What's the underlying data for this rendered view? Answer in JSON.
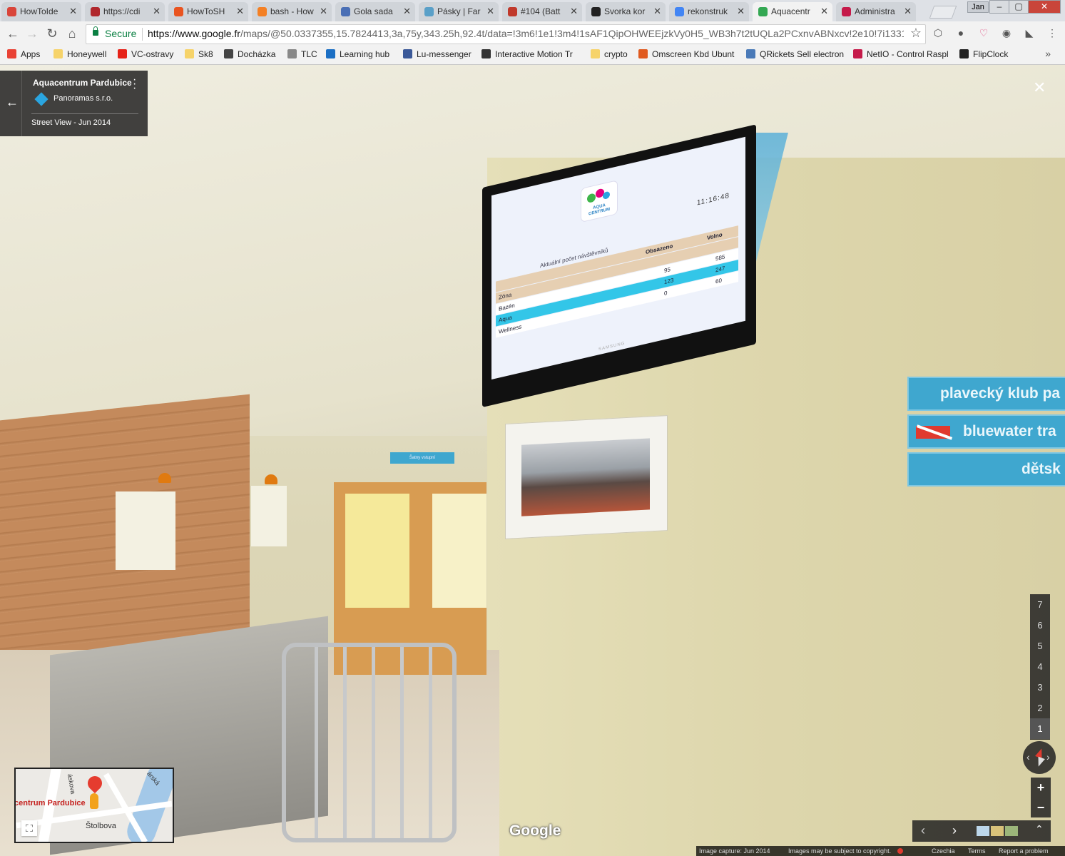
{
  "tabs": [
    {
      "title": "HowToIde",
      "icon": "howtoide-icon",
      "color": "#d9453a"
    },
    {
      "title": "https://cdi",
      "icon": "arrow-a-icon",
      "color": "#b0282d"
    },
    {
      "title": "HowToSH",
      "icon": "ubuntu-icon",
      "color": "#e95420"
    },
    {
      "title": "bash - How",
      "icon": "stackoverflow-icon",
      "color": "#f48024"
    },
    {
      "title": "Gola sada",
      "icon": "clip-icon",
      "color": "#4a6fb5"
    },
    {
      "title": "Pásky | Far",
      "icon": "tape-icon",
      "color": "#5aa0c8"
    },
    {
      "title": "#104 (Batt",
      "icon": "paw-icon",
      "color": "#c0392b"
    },
    {
      "title": "Svorka kor",
      "icon": "svorka-icon",
      "color": "#222222"
    },
    {
      "title": "rekonstruk",
      "icon": "google-icon",
      "color": "#4285f4"
    },
    {
      "title": "Aquacentr",
      "icon": "maps-icon",
      "color": "#34a853"
    },
    {
      "title": "Administra",
      "icon": "raspberry-icon",
      "color": "#c51a4a"
    }
  ],
  "window": {
    "user": "Jan"
  },
  "address": {
    "secure_label": "Secure",
    "url_host": "https://www.google.fr",
    "url_rest": "/maps/@50.0337355,15.7824413,3a,75y,343.25h,92.4t/data=!3m6!1e1!3m4!1sAF1QipOHWEEjzkVy0H5_WB3h7t2tUQLa2PCxnvABNxcv!2e10!7i13312!..."
  },
  "bookmarks": [
    {
      "label": "Apps",
      "icon": "apps-grid-icon",
      "color": "#e94235"
    },
    {
      "label": "Honeywell",
      "icon": "folder-icon",
      "color": "#f6d36a"
    },
    {
      "label": "VC-ostravy",
      "icon": "youtube-icon",
      "color": "#e62117"
    },
    {
      "label": "Sk8",
      "icon": "folder-icon",
      "color": "#f6d36a"
    },
    {
      "label": "Docházka",
      "icon": "clock-icon",
      "color": "#444444"
    },
    {
      "label": "TLC",
      "icon": "page-icon",
      "color": "#888888"
    },
    {
      "label": "Learning hub",
      "icon": "salesforce-icon",
      "color": "#1b6fc4"
    },
    {
      "label": "Lu-messenger",
      "icon": "facebook-icon",
      "color": "#3b5998"
    },
    {
      "label": "Interactive Motion Tr",
      "icon": "motion-icon",
      "color": "#333333"
    },
    {
      "label": "crypto",
      "icon": "folder-icon",
      "color": "#f6d36a"
    },
    {
      "label": "Omscreen Kbd Ubunt",
      "icon": "ask-icon",
      "color": "#e05a1f"
    },
    {
      "label": "QRickets Sell electron",
      "icon": "feather-icon",
      "color": "#4a7ab8"
    },
    {
      "label": "NetIO - Control Raspl",
      "icon": "raspberry-icon",
      "color": "#c51a4a"
    },
    {
      "label": "FlipClock",
      "icon": "flipclock-icon",
      "color": "#222222"
    }
  ],
  "place_card": {
    "title": "Aquacentrum Pardubice",
    "owner": "Panoramas s.r.o.",
    "date": "Street View - Jun 2014"
  },
  "tv": {
    "logo_text": "AQUA CENTRUM",
    "time": "11:16:48",
    "caption": "Aktuální počet návštěvníků",
    "col_occupied": "Obsazeno",
    "col_free": "Volno",
    "rows": [
      {
        "zone": "Zóna",
        "occupied": "",
        "free": ""
      },
      {
        "zone": "Bazén",
        "occupied": "95",
        "free": "585"
      },
      {
        "zone": "Aqua",
        "occupied": "123",
        "free": "247"
      },
      {
        "zone": "Wellness",
        "occupied": "0",
        "free": "60"
      }
    ],
    "brand": "SAMSUNG"
  },
  "signs": [
    "plavecký klub pa",
    "bluewater tra",
    "dětsk"
  ],
  "door_sign": "Šatny vstupní",
  "levels": [
    "7",
    "6",
    "5",
    "4",
    "3",
    "2",
    "1"
  ],
  "selected_level": "1",
  "minimap": {
    "label_place": "centrum Pardubice",
    "street1": "Štolbova",
    "street2": "áskova",
    "street3": "árská"
  },
  "google_logo": "Google",
  "footer": {
    "capture": "Image capture: Jun 2014",
    "copyright": "Images may be subject to copyright.",
    "region": "Czechia",
    "terms": "Terms",
    "report": "Report a problem"
  }
}
